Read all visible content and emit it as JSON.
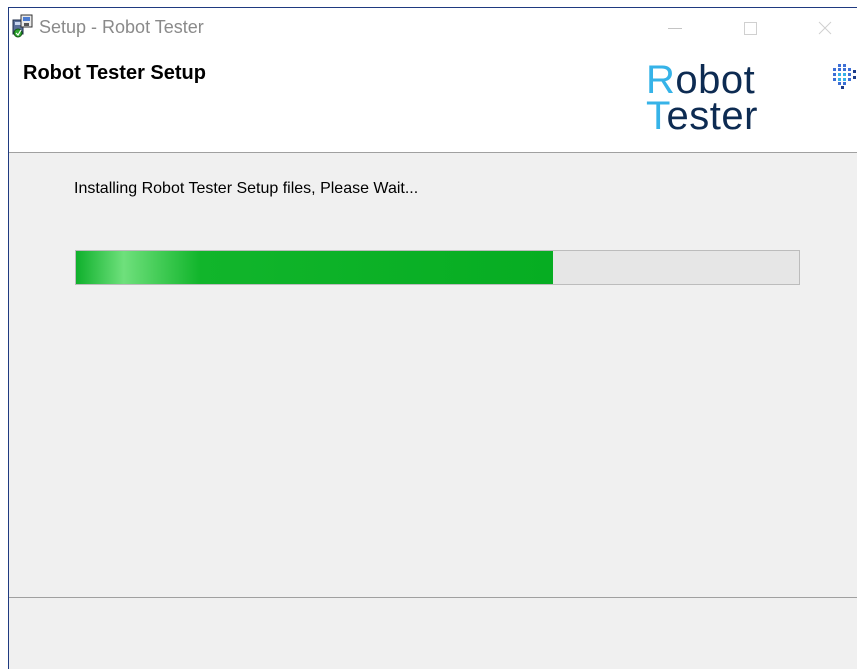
{
  "window": {
    "title": "Setup - Robot Tester",
    "controls": {
      "minimize": "—",
      "maximize": "☐",
      "close": "✕"
    }
  },
  "header": {
    "title": "Robot Tester Setup",
    "logo": {
      "line1_cap": "R",
      "line1_rest": "obot",
      "line2_cap": "T",
      "line2_rest": "ester",
      "cap_color": "#36b3e8",
      "text_color": "#0d2b52",
      "mark_icon": "robot-tester-logo-mark-icon"
    }
  },
  "main": {
    "status": "Installing Robot Tester Setup files, Please Wait...",
    "progress_fraction": 0.66,
    "progress_color": "#06ad22"
  }
}
